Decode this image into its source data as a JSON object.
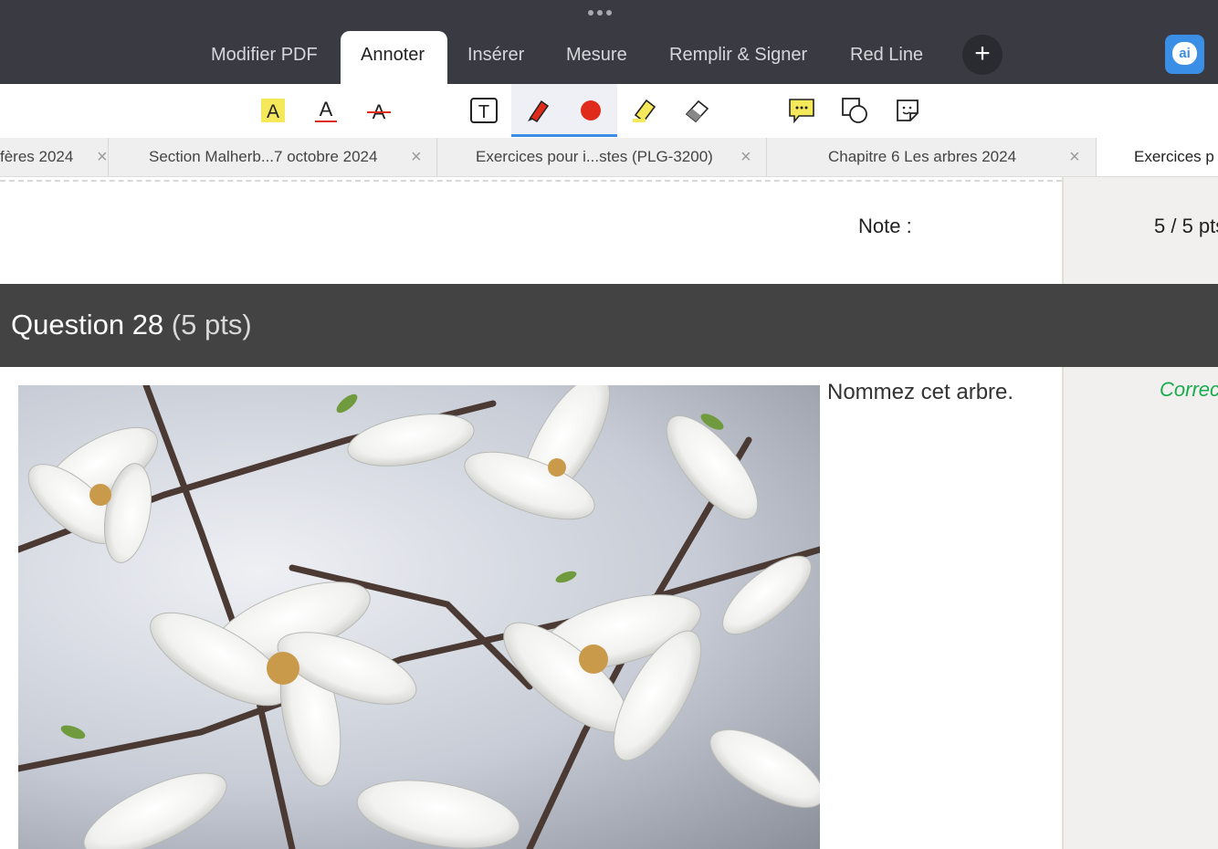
{
  "menu_tabs": [
    {
      "label": "Modifier PDF"
    },
    {
      "label": "Annoter"
    },
    {
      "label": "Insérer"
    },
    {
      "label": "Mesure"
    },
    {
      "label": "Remplir & Signer"
    },
    {
      "label": "Red Line"
    }
  ],
  "active_menu_tab": "Annoter",
  "ai_button_label": "ai",
  "toolbar": {
    "tools": [
      "highlight-text-icon",
      "underline-text-icon",
      "strikethrough-text-icon",
      "text-box-icon",
      "pen-icon",
      "color-picker-icon",
      "highlighter-icon",
      "eraser-icon",
      "comment-icon",
      "shapes-icon",
      "sticker-icon"
    ],
    "selected": [
      "pen-icon",
      "color-picker-icon"
    ],
    "pen_color": "#e02b1b",
    "highlight_color": "#f5e85a"
  },
  "doc_tabs": [
    {
      "title": "fères 2024"
    },
    {
      "title": "Section Malherb...7 octobre 2024"
    },
    {
      "title": "Exercices pour i...stes (PLG-3200)"
    },
    {
      "title": "Chapitre 6 Les arbres  2024"
    },
    {
      "title": "Exercices p"
    }
  ],
  "close_glyph": "×",
  "document": {
    "note_label": "Note :",
    "score": "5 / 5 pts",
    "question_title": "Question 28",
    "question_points": "(5 pts)",
    "question_text": "Nommez cet arbre.",
    "correction_label": "Correc"
  },
  "colors": {
    "topbar": "#3a3b42",
    "accent": "#3a8ee6",
    "correct": "#1aab4e",
    "question_bar": "#434343"
  }
}
